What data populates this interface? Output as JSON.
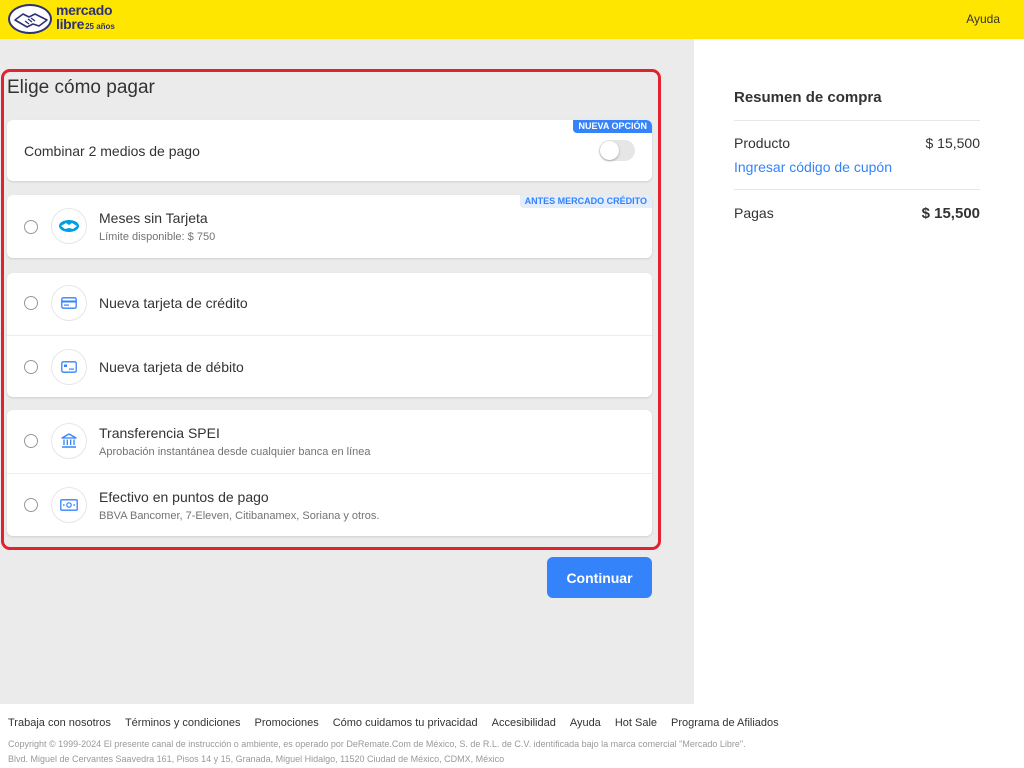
{
  "header": {
    "logo_line1": "mercado",
    "logo_line2": "libre",
    "logo_line3": "25 años",
    "help": "Ayuda",
    "brand_color": "#ffe600"
  },
  "main": {
    "title": "Elige cómo pagar",
    "combine": {
      "label": "Combinar 2 medios de pago",
      "tag": "NUEVA OPCIÓN",
      "toggle_on": false
    },
    "options": [
      {
        "title": "Meses sin Tarjeta",
        "subtitle": "Límite disponible: $ 750",
        "tag": "ANTES MERCADO CRÉDITO",
        "icon": "mercado-pago-icon"
      },
      {
        "title": "Nueva tarjeta de crédito",
        "subtitle": "",
        "icon": "credit-card-icon"
      },
      {
        "title": "Nueva tarjeta de débito",
        "subtitle": "",
        "icon": "debit-card-icon"
      },
      {
        "title": "Transferencia SPEI",
        "subtitle": "Aprobación instantánea desde cualquier banca en línea",
        "icon": "bank-icon"
      },
      {
        "title": "Efectivo en puntos de pago",
        "subtitle": "BBVA Bancomer, 7-Eleven, Citibanamex, Soriana y otros.",
        "icon": "cash-icon"
      }
    ],
    "continue_label": "Continuar",
    "accent": "#3483fa"
  },
  "summary": {
    "title": "Resumen de compra",
    "product_label": "Producto",
    "product_value": "$ 15,500",
    "coupon": "Ingresar código de cupón",
    "total_label": "Pagas",
    "total_value": "$ 15,500"
  },
  "footer": {
    "links": [
      "Trabaja con nosotros",
      "Términos y condiciones",
      "Promociones",
      "Cómo cuidamos tu privacidad",
      "Accesibilidad",
      "Ayuda",
      "Hot Sale",
      "Programa de Afiliados"
    ],
    "copyright": "Copyright © 1999-2024 El presente canal de instrucción o ambiente, es operado por DeRemate.Com de México, S. de R.L. de C.V. identificada bajo la marca comercial \"Mercado Libre\".",
    "address": "Blvd. Miguel de Cervantes Saavedra 161, Pisos 14 y 15, Granada, Miguel Hidalgo, 11520 Ciudad de México, CDMX, México"
  }
}
